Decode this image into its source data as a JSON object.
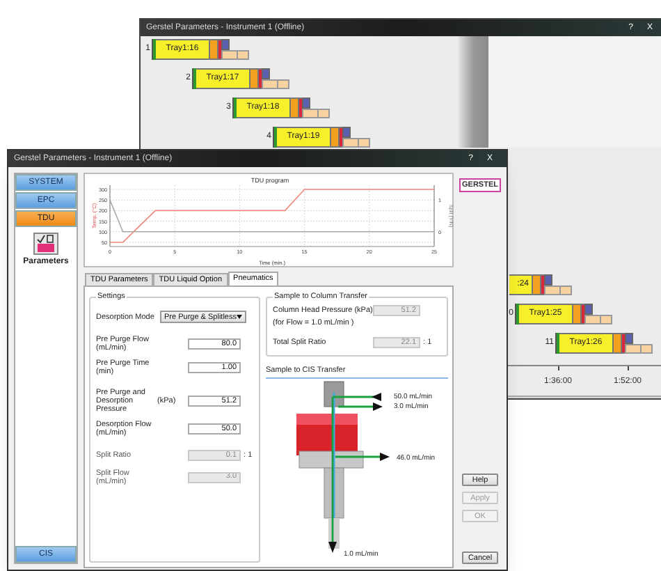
{
  "back_window": {
    "title": "Gerstel Parameters - Instrument 1 (Offline)",
    "title_buttons": [
      "?",
      "X"
    ],
    "top_rows": [
      {
        "number": "1",
        "label": "Tray1:16"
      },
      {
        "number": "2",
        "label": "Tray1:17"
      },
      {
        "number": "3",
        "label": "Tray1:18"
      },
      {
        "number": "4",
        "label": "Tray1:19"
      }
    ],
    "bottom_rows": [
      {
        "label": ":24"
      },
      {
        "number": "0",
        "label": "Tray1:25"
      },
      {
        "number": "11",
        "label": "Tray1:26"
      }
    ],
    "time_axis": [
      "1:36:00",
      "1:52:00"
    ]
  },
  "front_window": {
    "title": "Gerstel Parameters - Instrument 1 (Offline)",
    "title_buttons": [
      "?",
      "X"
    ],
    "sidebar": {
      "items": [
        {
          "label": "SYSTEM",
          "selected": false
        },
        {
          "label": "EPC",
          "selected": false
        },
        {
          "label": "TDU",
          "selected": true
        }
      ],
      "tool": {
        "label": "Parameters"
      },
      "bottom_items": [
        {
          "label": "CIS",
          "selected": false
        }
      ]
    },
    "chart": {
      "chart_data": {
        "type": "line",
        "title": "TDU program",
        "xlabel": "Time (min.)",
        "ylabel": "Temp. (°C)",
        "x": [
          0,
          1,
          3.5,
          13.5,
          15,
          25
        ],
        "series": [
          {
            "color": "#f08878",
            "values": [
              50,
              50,
              200,
              200,
              300,
              300
            ]
          },
          {
            "color": "#a8a8a8",
            "values": [
              250,
              100,
              100,
              100,
              100,
              100
            ]
          }
        ],
        "xlim": [
          0,
          25
        ],
        "ylim": [
          30,
          320
        ],
        "xticks": [
          0,
          5,
          10,
          15,
          20,
          25
        ],
        "yticks": [
          50,
          100,
          150,
          200,
          250,
          300
        ],
        "grid": true,
        "y2label": "Split (Y/N)",
        "y2lim": [
          -0.467,
          1.467
        ],
        "y2ticks": [
          0,
          1
        ]
      }
    },
    "logo": "GERSTEL",
    "tabs": [
      {
        "label": "TDU Parameters",
        "selected": false
      },
      {
        "label": "TDU Liquid Option",
        "selected": false
      },
      {
        "label": "Pneumatics",
        "selected": true
      }
    ],
    "settings": {
      "title": "Settings",
      "mode": {
        "label": "Desorption Mode",
        "value": "Pre Purge & Splitless"
      },
      "field_groups": [
        [
          {
            "label": "Pre Purge Flow (mL/min)",
            "value": "80.0",
            "disabled": false
          },
          {
            "label": "Pre Purge Time (min)",
            "value": "1.00",
            "disabled": false
          }
        ],
        [
          {
            "label": "Pre Purge and Desorption Pressure",
            "unit": "(kPa)",
            "value": "51.2",
            "disabled": false
          },
          {
            "label": "Desorption Flow (mL/min)",
            "value": "50.0",
            "disabled": false
          }
        ],
        [
          {
            "label": "Split Ratio",
            "value": "0.1",
            "suffix": ": 1",
            "disabled": true
          },
          {
            "label": "Split Flow (mL/min)",
            "value": "3.0",
            "disabled": true
          }
        ]
      ]
    },
    "column_transfer": {
      "title": "Sample to Column Transfer",
      "fields": [
        {
          "label": "Column Head Pressure  (kPa)",
          "note": "(for Flow = 1.0 mL/min )",
          "value": "51.2",
          "disabled": true
        },
        {
          "label": "Total Split Ratio",
          "value": "22.1",
          "suffix": ": 1",
          "disabled": true
        }
      ]
    },
    "cis_transfer": {
      "title": "Sample to CIS Transfer",
      "flows": [
        "50.0 mL/min",
        "3.0 mL/min",
        "46.0 mL/min",
        "1.0 mL/min"
      ]
    },
    "buttons": [
      {
        "label": "Help",
        "disabled": false
      },
      {
        "label": "Apply",
        "disabled": true
      },
      {
        "label": "OK",
        "disabled": true
      },
      {
        "label": "Cancel",
        "disabled": false
      }
    ]
  }
}
